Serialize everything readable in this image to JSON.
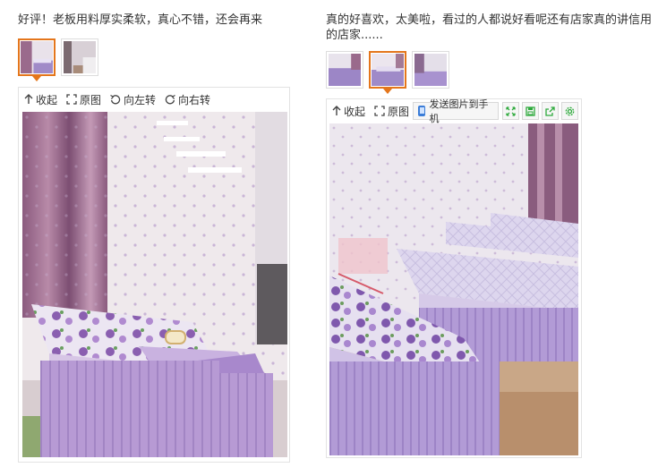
{
  "reviews": [
    {
      "text": "好评！老板用料厚实柔软，真心不错，还会再来",
      "toolbar": {
        "collapse": "收起",
        "original": "原图",
        "rotate_left": "向左转",
        "rotate_right": "向右转"
      }
    },
    {
      "text": "真的好喜欢，太美啦，看过的人都说好看呢还有店家真的讲信用的店家......",
      "toolbar": {
        "collapse": "收起",
        "original": "原图",
        "send_to_phone": "发送图片到手机"
      }
    }
  ],
  "colors": {
    "accent": "#e4761c",
    "toolbar_green": "#2eaa3c"
  },
  "icons": [
    "collapse-arrow-icon",
    "expand-icon",
    "rotate-left-icon",
    "rotate-right-icon",
    "phone-icon",
    "fullscreen-icon",
    "save-icon",
    "share-icon",
    "settings-icon"
  ]
}
